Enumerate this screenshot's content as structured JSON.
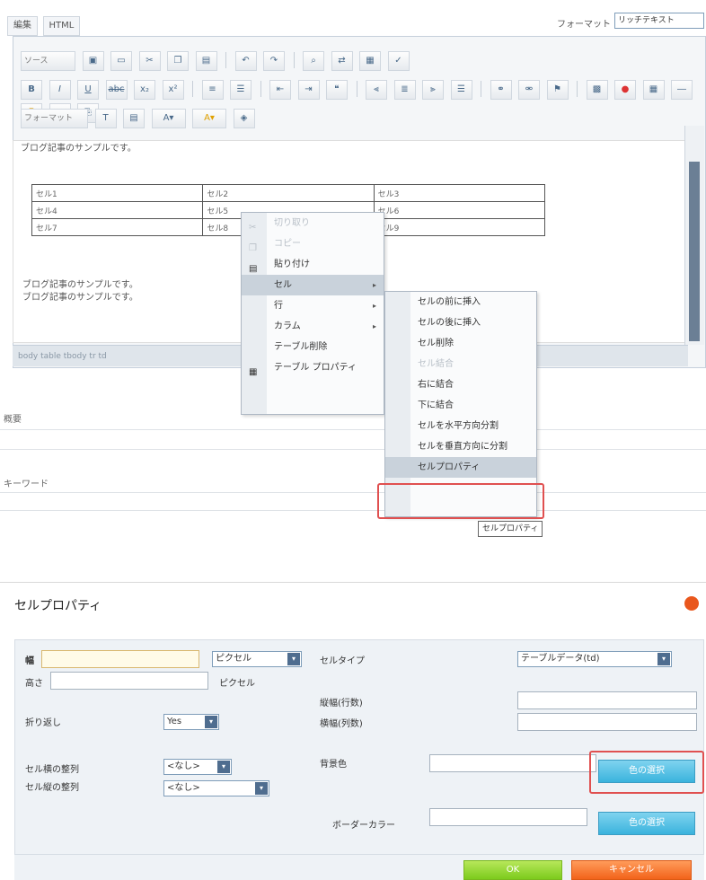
{
  "editor": {
    "tabs": [
      "編集",
      "HTML"
    ],
    "format_label": "フォーマット",
    "format_value": "リッチテキスト",
    "toolbar_source_label": "ソース",
    "toolbar_font_label": "フォーマット",
    "intro_text": "ブログ記事のサンプルです。",
    "table_rows": [
      [
        "セル1",
        "セル2",
        "セル3"
      ],
      [
        "セル4",
        "セル5",
        "セル6"
      ],
      [
        "セル7",
        "セル8",
        "セル9"
      ]
    ],
    "body_lines": [
      "ブログ記事のサンプルです。",
      "ブログ記事のサンプルです。"
    ],
    "status_path": "body table tbody tr td"
  },
  "context_menu": {
    "items": [
      "切り取り",
      "コピー",
      "貼り付け",
      "セル",
      "行",
      "カラム",
      "テーブル削除",
      "テーブル プロパティ"
    ]
  },
  "cell_submenu": {
    "items": [
      "セルの前に挿入",
      "セルの後に挿入",
      "セル削除",
      "セル結合",
      "右に結合",
      "下に結合",
      "セルを水平方向分割",
      "セルを垂直方向に分割",
      "セルプロパティ"
    ]
  },
  "tooltip": "セルプロパティ",
  "form": {
    "summary_label": "概要",
    "keyword_label": "キーワード"
  },
  "dialog": {
    "title": "セルプロパティ",
    "width_label": "幅",
    "width_unit": "ピクセル",
    "height_label": "高さ",
    "height_unit": "ピクセル",
    "wrap_label": "折り返し",
    "wrap_value": "Yes",
    "halign_label": "セル横の整列",
    "halign_value": "<なし>",
    "valign_label": "セル縦の整列",
    "valign_value": "<なし>",
    "celltype_label": "セルタイプ",
    "celltype_value": "テーブルデータ(td)",
    "rowspan_label": "縦幅(行数)",
    "colspan_label": "横幅(列数)",
    "bgcolor_label": "背景色",
    "bordercolor_label": "ボーダーカラー",
    "choose_color_label": "色の選択",
    "ok_label": "OK",
    "cancel_label": "キャンセル"
  },
  "colors": {
    "accent_orange": "#f2631a",
    "accent_green": "#7ccb1c",
    "accent_blue": "#3ab3dd",
    "highlight_red": "#e05050"
  }
}
